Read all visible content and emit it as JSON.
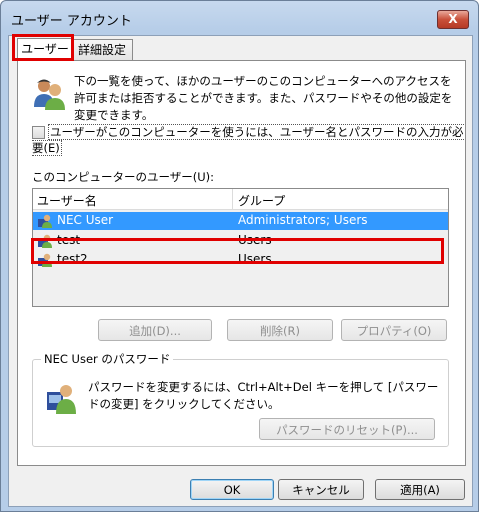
{
  "window": {
    "title": "ユーザー アカウント",
    "close_glyph": "X"
  },
  "tabs": [
    {
      "label": "ユーザー"
    },
    {
      "label": "詳細設定"
    }
  ],
  "intro_text": "下の一覧を使って、ほかのユーザーのこのコンピューターへのアクセスを許可または拒否することができます。また、パスワードやその他の設定を変更できます。",
  "require_password": {
    "label": "ユーザーがこのコンピューターを使うには、ユーザー名とパスワードの入力が必要(E)",
    "checked": false
  },
  "users_list": {
    "label": "このコンピューターのユーザー(U):",
    "columns": [
      "ユーザー名",
      "グループ"
    ],
    "rows": [
      {
        "name": "NEC User",
        "group": "Administrators; Users",
        "selected": true
      },
      {
        "name": "test",
        "group": "Users",
        "selected": false
      },
      {
        "name": "test2",
        "group": "Users",
        "selected": false
      }
    ]
  },
  "list_buttons": {
    "add": "追加(D)...",
    "delete": "削除(R)",
    "properties": "プロパティ(O)"
  },
  "password_group": {
    "title": "NEC User のパスワード",
    "text": "パスワードを変更するには、Ctrl+Alt+Del キーを押して [パスワードの変更] をクリックしてください。",
    "reset_button": "パスワードのリセット(P)..."
  },
  "dialog_buttons": {
    "ok": "OK",
    "cancel": "キャンセル",
    "apply": "適用(A)"
  },
  "colors": {
    "selection": "#3399ff",
    "annotation": "#e00000"
  }
}
